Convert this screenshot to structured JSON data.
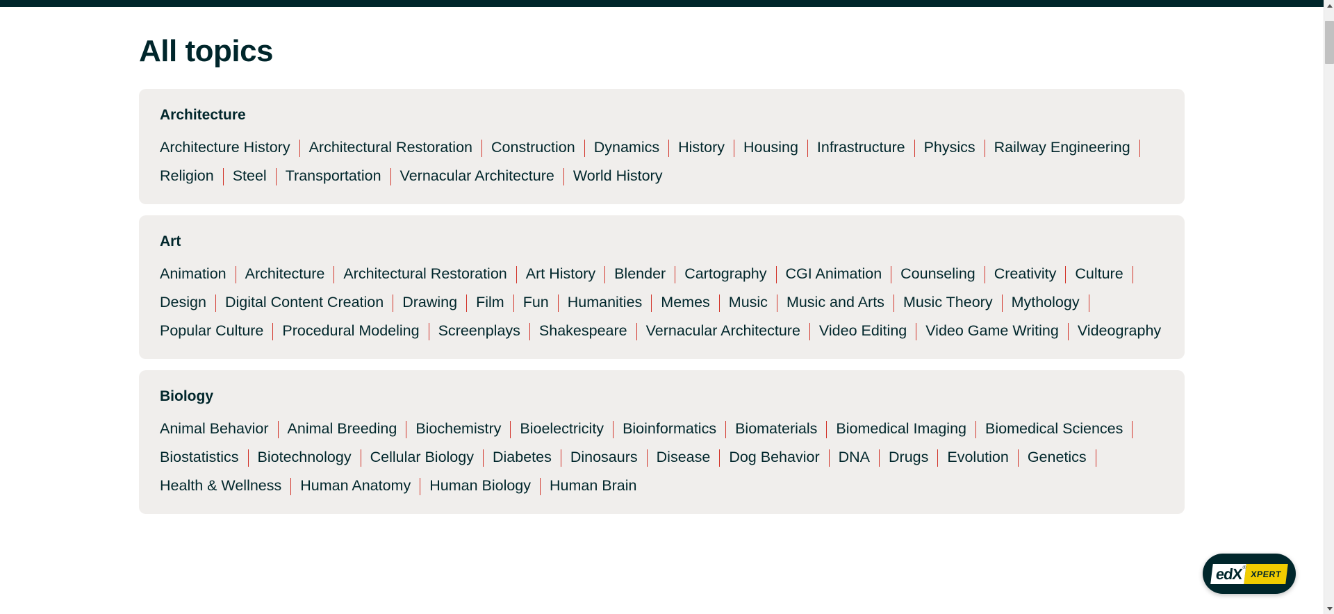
{
  "page": {
    "title": "All topics",
    "accent_color": "#00262B",
    "separator_color": "#D23228",
    "card_background": "#F0EEEC"
  },
  "topic_groups": [
    {
      "name": "Architecture",
      "topics": [
        "Architecture History",
        "Architectural Restoration",
        "Construction",
        "Dynamics",
        "History",
        "Housing",
        "Infrastructure",
        "Physics",
        "Railway Engineering",
        "Religion",
        "Steel",
        "Transportation",
        "Vernacular Architecture",
        "World History"
      ]
    },
    {
      "name": "Art",
      "topics": [
        "Animation",
        "Architecture",
        "Architectural Restoration",
        "Art History",
        "Blender",
        "Cartography",
        "CGI Animation",
        "Counseling",
        "Creativity",
        "Culture",
        "Design",
        "Digital Content Creation",
        "Drawing",
        "Film",
        "Fun",
        "Humanities",
        "Memes",
        "Music",
        "Music and Arts",
        "Music Theory",
        "Mythology",
        "Popular Culture",
        "Procedural Modeling",
        "Screenplays",
        "Shakespeare",
        "Vernacular Architecture",
        "Video Editing",
        "Video Game Writing",
        "Videography"
      ]
    },
    {
      "name": "Biology",
      "topics": [
        "Animal Behavior",
        "Animal Breeding",
        "Biochemistry",
        "Bioelectricity",
        "Bioinformatics",
        "Biomaterials",
        "Biomedical Imaging",
        "Biomedical Sciences",
        "Biostatistics",
        "Biotechnology",
        "Cellular Biology",
        "Diabetes",
        "Dinosaurs",
        "Disease",
        "Dog Behavior",
        "DNA",
        "Drugs",
        "Evolution",
        "Genetics",
        "Health & Wellness",
        "Human Anatomy",
        "Human Biology",
        "Human Brain"
      ]
    }
  ],
  "xpert_widget": {
    "brand": "edX",
    "registered_mark": "®",
    "badge": "XPERT"
  },
  "scrollbar": {
    "up_arrow": "scroll-up-arrow",
    "down_arrow": "scroll-down-arrow"
  }
}
